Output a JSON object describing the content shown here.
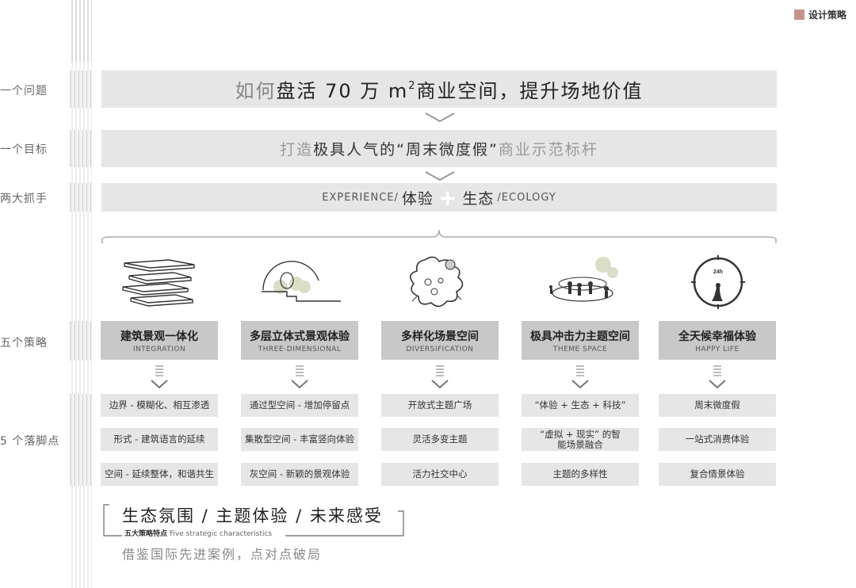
{
  "header": {
    "title": "设计策略",
    "accent_color": "#c4938b"
  },
  "row_labels": {
    "problem": "一个问题",
    "goal": "一个目标",
    "levers": "两大抓手",
    "strategies": "五个策略",
    "points": "5 个落脚点"
  },
  "problem": {
    "prefix": "如何",
    "text1": "盘活 70 万 m",
    "sup": "2",
    "text2": " 商业空间，提升场地价值"
  },
  "goal": {
    "prefix": "打造",
    "emph": "极具人气的",
    "quote": "“周末微度假”",
    "suffix": "商业示范标杆"
  },
  "levers": {
    "en_left": "EXPERIENCE/",
    "cn_left": "体验",
    "plus": "+",
    "cn_right": "生态",
    "en_right": "/ECOLOGY"
  },
  "strategies": [
    {
      "cn": "建筑景观一体化",
      "en": "INTEGRATION",
      "icon": "stacked-slabs-icon",
      "points": [
        "边界 - 模糊化、相互渗透",
        "形式 - 建筑语言的延续",
        "空间 - 延续整体，和谐共生"
      ]
    },
    {
      "cn": "多层立体式景观体验",
      "en": "THREE-DIMENSIONAL",
      "icon": "terraced-dome-icon",
      "points": [
        "通过型空间 - 增加停留点",
        "集散型空间 - 丰富竖向体验",
        "灰空间 - 新颖的景观体验"
      ]
    },
    {
      "cn": "多样化场景空间",
      "en": "DIVERSIFICATION",
      "icon": "diverse-bubble-icon",
      "points": [
        "开放式主题广场",
        "灵活多变主题",
        "活力社交中心"
      ]
    },
    {
      "cn": "极具冲击力主题空间",
      "en": "THEME SPACE",
      "icon": "people-gathering-icon",
      "points": [
        "“体验 + 生态 + 科技”",
        "“虚拟 + 现实” 的智能场景融合",
        "主题的多样性"
      ]
    },
    {
      "cn": "全天候幸福体验",
      "en": "HAPPY LIFE",
      "icon": "clock-24h-icon",
      "clock_label": "24h",
      "points": [
        "周末微度假",
        "一站式消费体验",
        "复合情景体验"
      ]
    }
  ],
  "bottom": {
    "title": "生态氛围 / 主题体验 / 未来感受",
    "sub_cn": "五大策略特点",
    "sub_en": "Five strategic characteristics",
    "footer": "借鉴国际先进案例，点对点破局"
  }
}
